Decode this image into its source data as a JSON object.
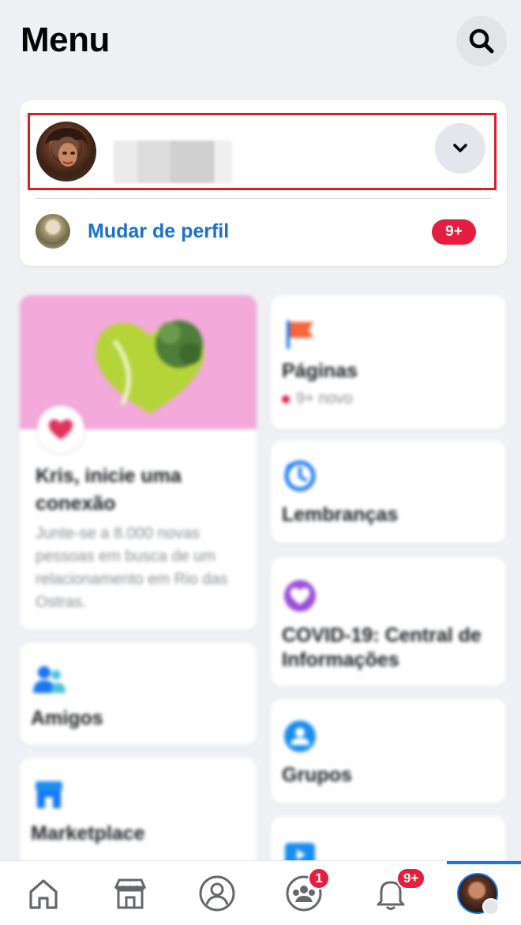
{
  "header": {
    "title": "Menu",
    "search_icon": "search-icon"
  },
  "profile": {
    "chevron_icon": "chevron-down-icon",
    "switch_label": "Mudar de perfil",
    "switch_badge": "9+"
  },
  "shortcuts": {
    "dating": {
      "title": "Kris, inicie uma conexão",
      "description": "Junte-se a 8.000 novas pessoas em busca de um relacionamento em Rio das Ostras."
    },
    "pages": {
      "label": "Páginas",
      "subtitle": "9+ novo"
    },
    "memories": {
      "label": "Lembranças"
    },
    "covid": {
      "label": "COVID-19: Central de Informações"
    },
    "friends": {
      "label": "Amigos"
    },
    "groups": {
      "label": "Grupos"
    },
    "marketplace": {
      "label": "Marketplace"
    }
  },
  "bottom_nav": {
    "groups_badge": "1",
    "notifications_badge": "9+"
  },
  "colors": {
    "accent": "#1877f2",
    "link": "#1a73c7",
    "badge": "#e41e3f",
    "highlight_frame": "#d42028"
  }
}
